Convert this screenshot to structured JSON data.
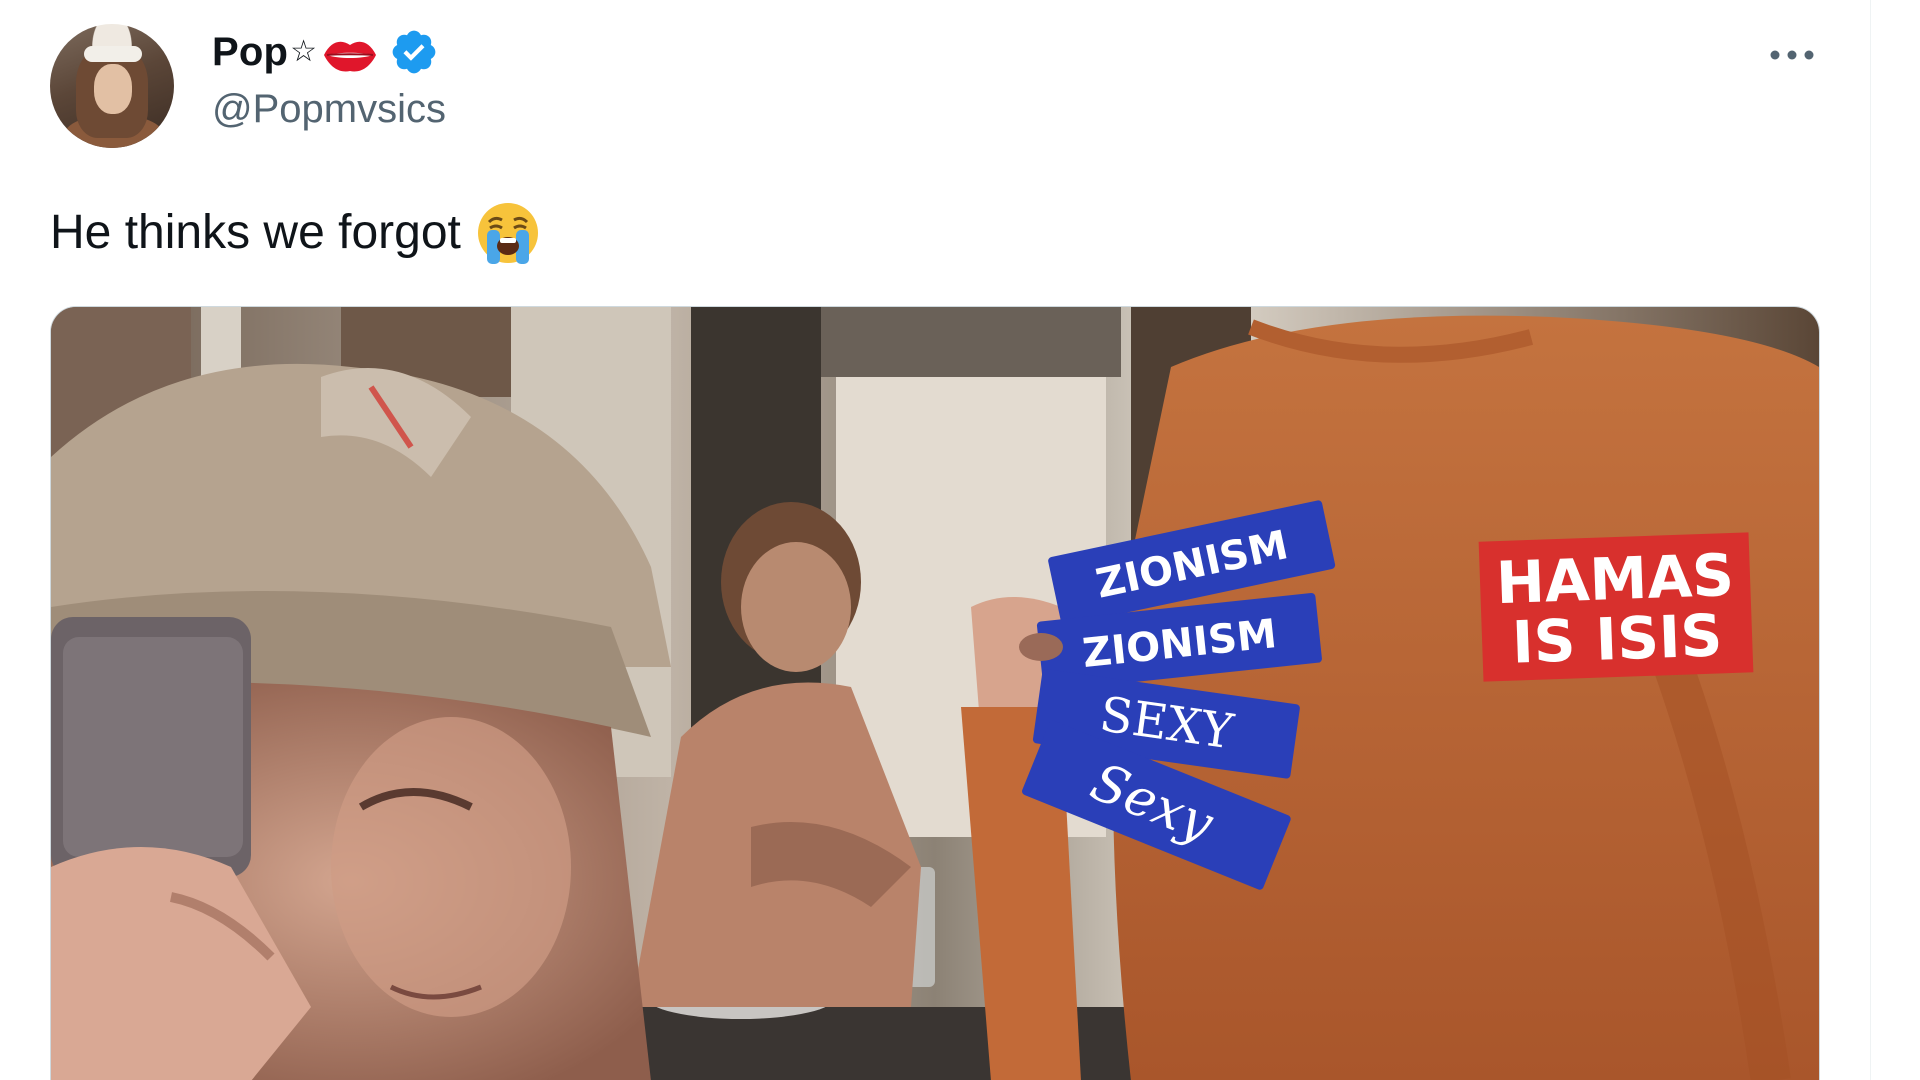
{
  "author": {
    "display_name": "Pop",
    "handle": "@Popmvsics",
    "avatar": "avatar-photo",
    "verified": true
  },
  "tweet": {
    "text": "He thinks we forgot",
    "emoji": "loudly-crying-face",
    "media": {
      "type": "photo",
      "sticker_texts": [
        "ZIONISM",
        "SEXY",
        "ZIONISM",
        "SEXY"
      ],
      "shirt_sticker_text": "HAMAS IS ISIS"
    }
  },
  "colors": {
    "text_primary": "#0f1419",
    "text_secondary": "#536471",
    "verified_blue": "#1d9bf0",
    "sticker_blue": "#2a3fb8",
    "sticker_red": "#d8302d",
    "sweater_orange": "#c9703a"
  },
  "icons": [
    "star-icon",
    "lips-icon",
    "verified-badge-icon",
    "more-options-icon",
    "crying-face-emoji"
  ]
}
